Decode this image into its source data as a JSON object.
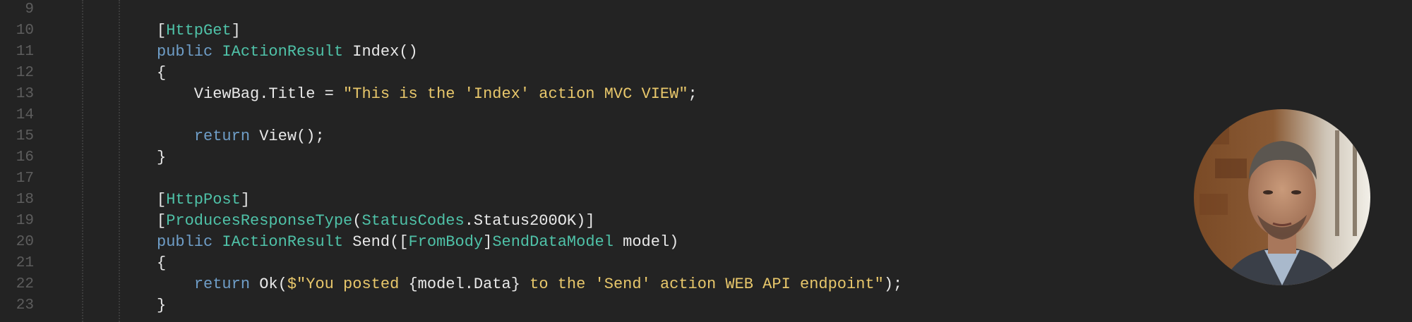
{
  "editor": {
    "lines": [
      {
        "n": "9",
        "segs": []
      },
      {
        "n": "10",
        "segs": [
          {
            "t": "[",
            "c": "pl"
          },
          {
            "t": "HttpGet",
            "c": "ty"
          },
          {
            "t": "]",
            "c": "pl"
          }
        ]
      },
      {
        "n": "11",
        "segs": [
          {
            "t": "public ",
            "c": "kw"
          },
          {
            "t": "IActionResult",
            "c": "ty"
          },
          {
            "t": " Index()",
            "c": "pl"
          }
        ]
      },
      {
        "n": "12",
        "segs": [
          {
            "t": "{",
            "c": "pl"
          }
        ]
      },
      {
        "n": "13",
        "segs": [
          {
            "t": "    ViewBag.Title = ",
            "c": "pl"
          },
          {
            "t": "\"This is the 'Index' action MVC VIEW\"",
            "c": "st"
          },
          {
            "t": ";",
            "c": "pl"
          }
        ]
      },
      {
        "n": "14",
        "segs": []
      },
      {
        "n": "15",
        "segs": [
          {
            "t": "    ",
            "c": "pl"
          },
          {
            "t": "return",
            "c": "kw"
          },
          {
            "t": " View();",
            "c": "pl"
          }
        ]
      },
      {
        "n": "16",
        "segs": [
          {
            "t": "}",
            "c": "pl"
          }
        ]
      },
      {
        "n": "17",
        "segs": []
      },
      {
        "n": "18",
        "segs": [
          {
            "t": "[",
            "c": "pl"
          },
          {
            "t": "HttpPost",
            "c": "ty"
          },
          {
            "t": "]",
            "c": "pl"
          }
        ]
      },
      {
        "n": "19",
        "segs": [
          {
            "t": "[",
            "c": "pl"
          },
          {
            "t": "ProducesResponseType",
            "c": "ty"
          },
          {
            "t": "(",
            "c": "pl"
          },
          {
            "t": "StatusCodes",
            "c": "ty"
          },
          {
            "t": ".Status200OK)]",
            "c": "pl"
          }
        ]
      },
      {
        "n": "20",
        "segs": [
          {
            "t": "public ",
            "c": "kw"
          },
          {
            "t": "IActionResult",
            "c": "ty"
          },
          {
            "t": " Send([",
            "c": "pl"
          },
          {
            "t": "FromBody",
            "c": "ty"
          },
          {
            "t": "]",
            "c": "pl"
          },
          {
            "t": "SendDataModel",
            "c": "ty"
          },
          {
            "t": " model)",
            "c": "pl"
          }
        ]
      },
      {
        "n": "21",
        "segs": [
          {
            "t": "{",
            "c": "pl"
          }
        ]
      },
      {
        "n": "22",
        "segs": [
          {
            "t": "    ",
            "c": "pl"
          },
          {
            "t": "return",
            "c": "kw"
          },
          {
            "t": " Ok(",
            "c": "pl"
          },
          {
            "t": "$\"You posted ",
            "c": "st"
          },
          {
            "t": "{model.Data}",
            "c": "pl"
          },
          {
            "t": " to the 'Send' action WEB API endpoint\"",
            "c": "st"
          },
          {
            "t": ");",
            "c": "pl"
          }
        ]
      },
      {
        "n": "23",
        "segs": [
          {
            "t": "}",
            "c": "pl"
          }
        ]
      }
    ]
  },
  "colors": {
    "background": "#232323",
    "keyword": "#6f9ec8",
    "type": "#4fc2a8",
    "string": "#e8c76b",
    "line_number": "#5d5d5d"
  },
  "avatar": {
    "icon": "presenter-webcam-avatar"
  }
}
